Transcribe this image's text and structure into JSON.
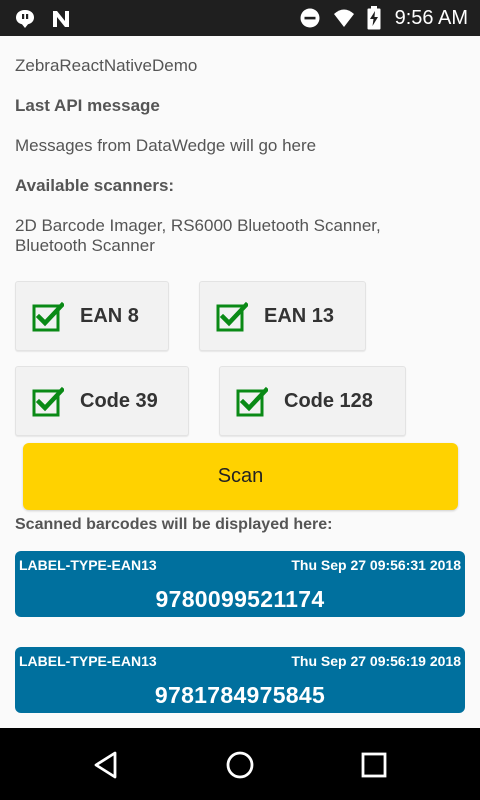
{
  "status_bar": {
    "time": "9:56 AM",
    "left_icons": [
      "message-icon",
      "n-logo-icon"
    ],
    "right_icons": [
      "do-not-disturb-icon",
      "wifi-icon",
      "battery-charging-icon"
    ]
  },
  "app": {
    "title": "ZebraReactNativeDemo",
    "last_api_heading": "Last API message",
    "last_api_message": "Messages from DataWedge will go here",
    "scanners_heading": "Available scanners:",
    "scanners_line1": "2D Barcode Imager, RS6000 Bluetooth Scanner,",
    "scanners_line2": "Bluetooth Scanner"
  },
  "decoders": [
    {
      "label": "EAN 8",
      "checked": true
    },
    {
      "label": "EAN 13",
      "checked": true
    },
    {
      "label": "Code 39",
      "checked": true
    },
    {
      "label": "Code 128",
      "checked": true
    }
  ],
  "scan_button": {
    "label": "Scan"
  },
  "scanned_heading": "Scanned barcodes will be displayed here:",
  "barcodes": [
    {
      "type": "LABEL-TYPE-EAN13",
      "timestamp": "Thu Sep 27 09:56:31 2018",
      "value": "9780099521174"
    },
    {
      "type": "LABEL-TYPE-EAN13",
      "timestamp": "Thu Sep 27 09:56:19 2018",
      "value": "9781784975845"
    }
  ],
  "colors": {
    "accent_yellow": "#ffd200",
    "card_blue": "#00709e",
    "check_green": "#0a8a16"
  },
  "nav_bar": {
    "buttons": [
      "back-icon",
      "home-icon",
      "recents-icon"
    ]
  }
}
